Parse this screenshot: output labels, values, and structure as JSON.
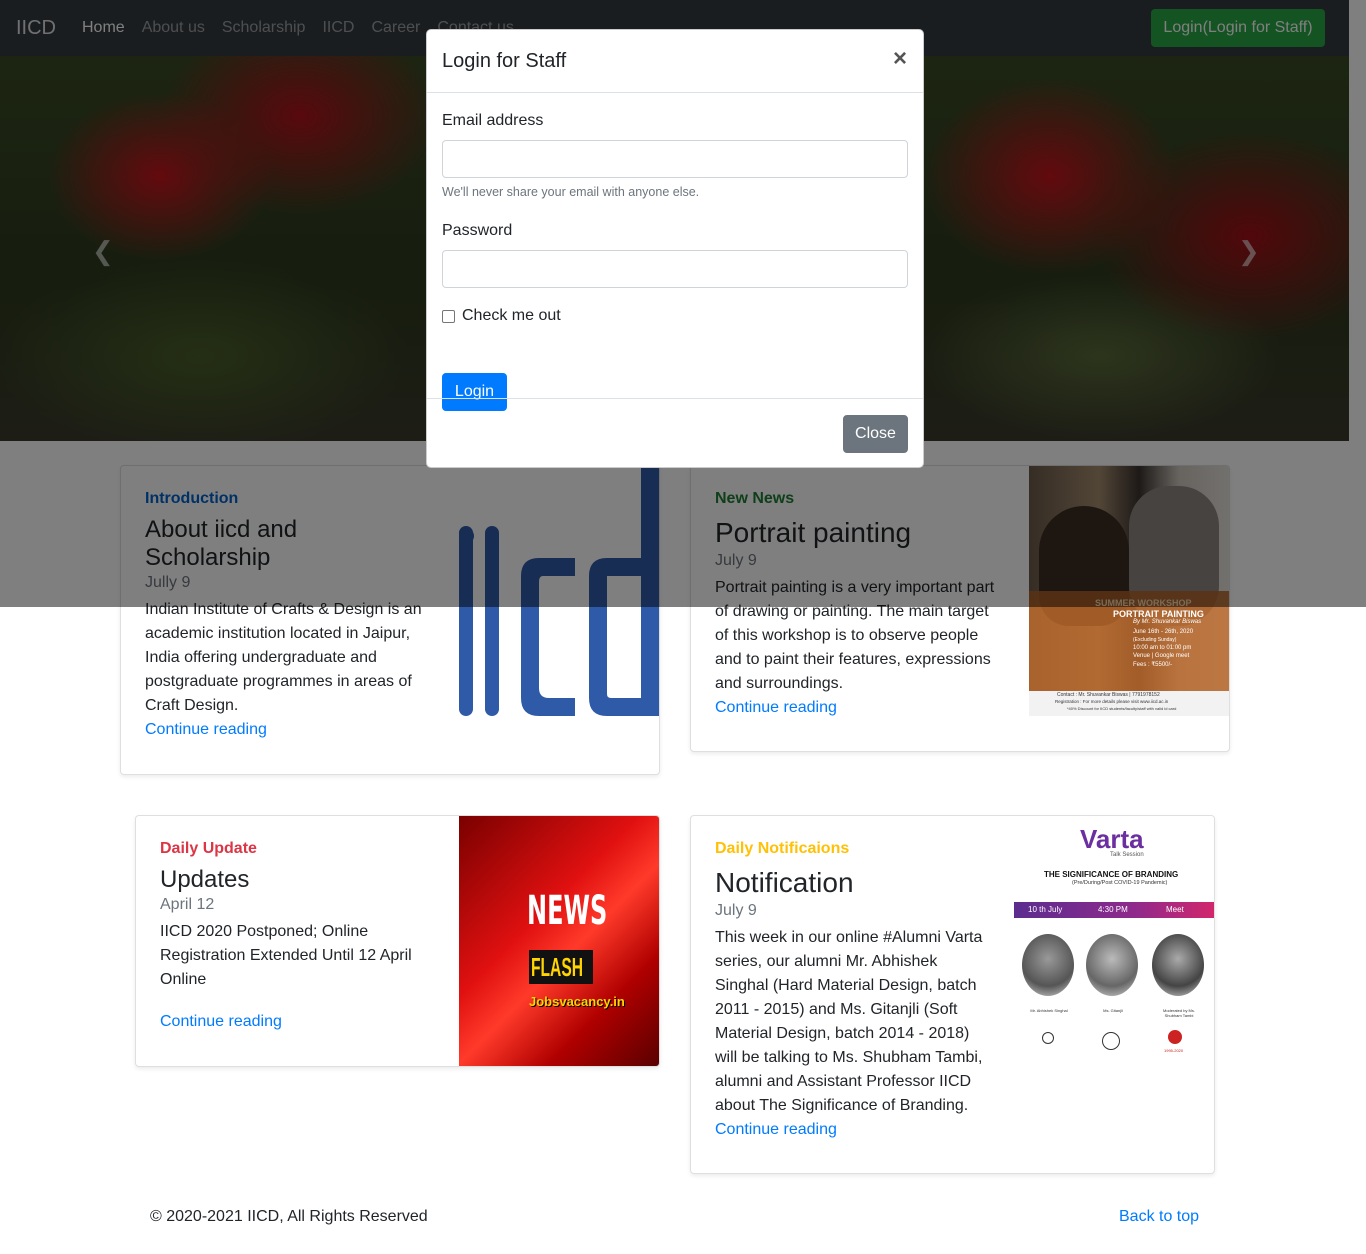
{
  "nav": {
    "brand": "IICD",
    "links": [
      "Home",
      "About us",
      "Scholarship",
      "IICD",
      "Career",
      "Contact us"
    ],
    "login_button": "Login(Login for Staff)"
  },
  "carousel": {
    "prev_icon": "chevron-left-icon",
    "next_icon": "chevron-right-icon"
  },
  "cards": [
    {
      "category": "Introduction",
      "title_line1": "About iicd and",
      "title_line2": "Scholarship",
      "date": "Jully 9",
      "text": [
        "Indian Institute of Crafts & Design is an",
        "academic institution located in Jaipur,",
        "India offering undergraduate and",
        "postgraduate programmes in areas of",
        "Craft Design."
      ],
      "link": "Continue reading",
      "image_logo": "iicd"
    },
    {
      "category": "New News",
      "title": "Portrait painting",
      "date": "July 9",
      "text": [
        "Portrait painting is a very important part",
        "of drawing or painting. The main target",
        "of this workshop is to observe people",
        "and to paint their features, expressions",
        "and surroundings."
      ],
      "link": "Continue reading",
      "poster": {
        "heading": "SUMMER WORKSHOP",
        "subheading": "PORTRAIT PAINTING",
        "by": "By Mr. Shuvankar Biswas",
        "dates": "June 16th - 26th, 2020",
        "excl": "(Excluding Sunday)",
        "time": "10:00 am to 01:00 pm",
        "venue": "Venue | Google meet",
        "fees": "Fees : ₹5500/-",
        "contact": "Contact : Mr. Shuvankar Biswas | 7791978152",
        "registration": "Registration : For more details please visit www.iicd.ac.in",
        "discount": "*40% Discount for IICD students/faculty/staff with valid id card"
      }
    },
    {
      "category": "Daily Update",
      "title": "Updates",
      "date": "April 12",
      "text": [
        "IICD 2020 Postponed; Online",
        "Registration Extended Until 12 April",
        "Online"
      ],
      "link": "Continue reading",
      "news_image": {
        "line1": "NEWS",
        "line2": "FLASH",
        "line3": "Jobsvacancy.in"
      }
    },
    {
      "category": "Daily Notificaions",
      "title": "Notification",
      "date": "July 9",
      "text": [
        "This week in our online #Alumni Varta",
        "series, our alumni Mr. Abhishek",
        "Singhal (Hard Material Design, batch",
        "2011 - 2015) and Ms. Gitanjli (Soft",
        "Material Design, batch 2014 - 2018)",
        "will be talking to Ms. Shubham Tambi,",
        "alumni and Assistant Professor IICD",
        "about The Significance of Branding."
      ],
      "link": "Continue reading",
      "varta": {
        "logo": "Varta",
        "sub": "Talk Session",
        "headline": "THE SIGNIFICANCE OF BRANDING",
        "headline_sub": "(Pre/During/Post COVID-19 Pandemic)",
        "date": "10 th July",
        "time": "4:30 PM",
        "meet": "Meet",
        "speaker1": "Mr. Abhishek Singhal",
        "speaker2": "Ms. Gitanjli",
        "speaker3": "Moderated by Ms. Shubham Tambi",
        "years": "1995-2020"
      }
    }
  ],
  "modal": {
    "title": "Login for Staff",
    "close_symbol": "×",
    "email_label": "Email address",
    "email_value": "",
    "email_help": "We'll never share your email with anyone else.",
    "password_label": "Password",
    "password_value": "",
    "checkbox_label": "Check me out",
    "login_button": "Login",
    "close_button": "Close"
  },
  "footer": {
    "copyright": "© 2020-2021 IICD, All Rights Reserved",
    "back_to_top": "Back to top"
  },
  "colors": {
    "navbar": "#343a40",
    "success": "#28a745",
    "primary": "#007bff",
    "secondary": "#6c757d",
    "danger": "#dc3545",
    "warning": "#ffc107"
  }
}
